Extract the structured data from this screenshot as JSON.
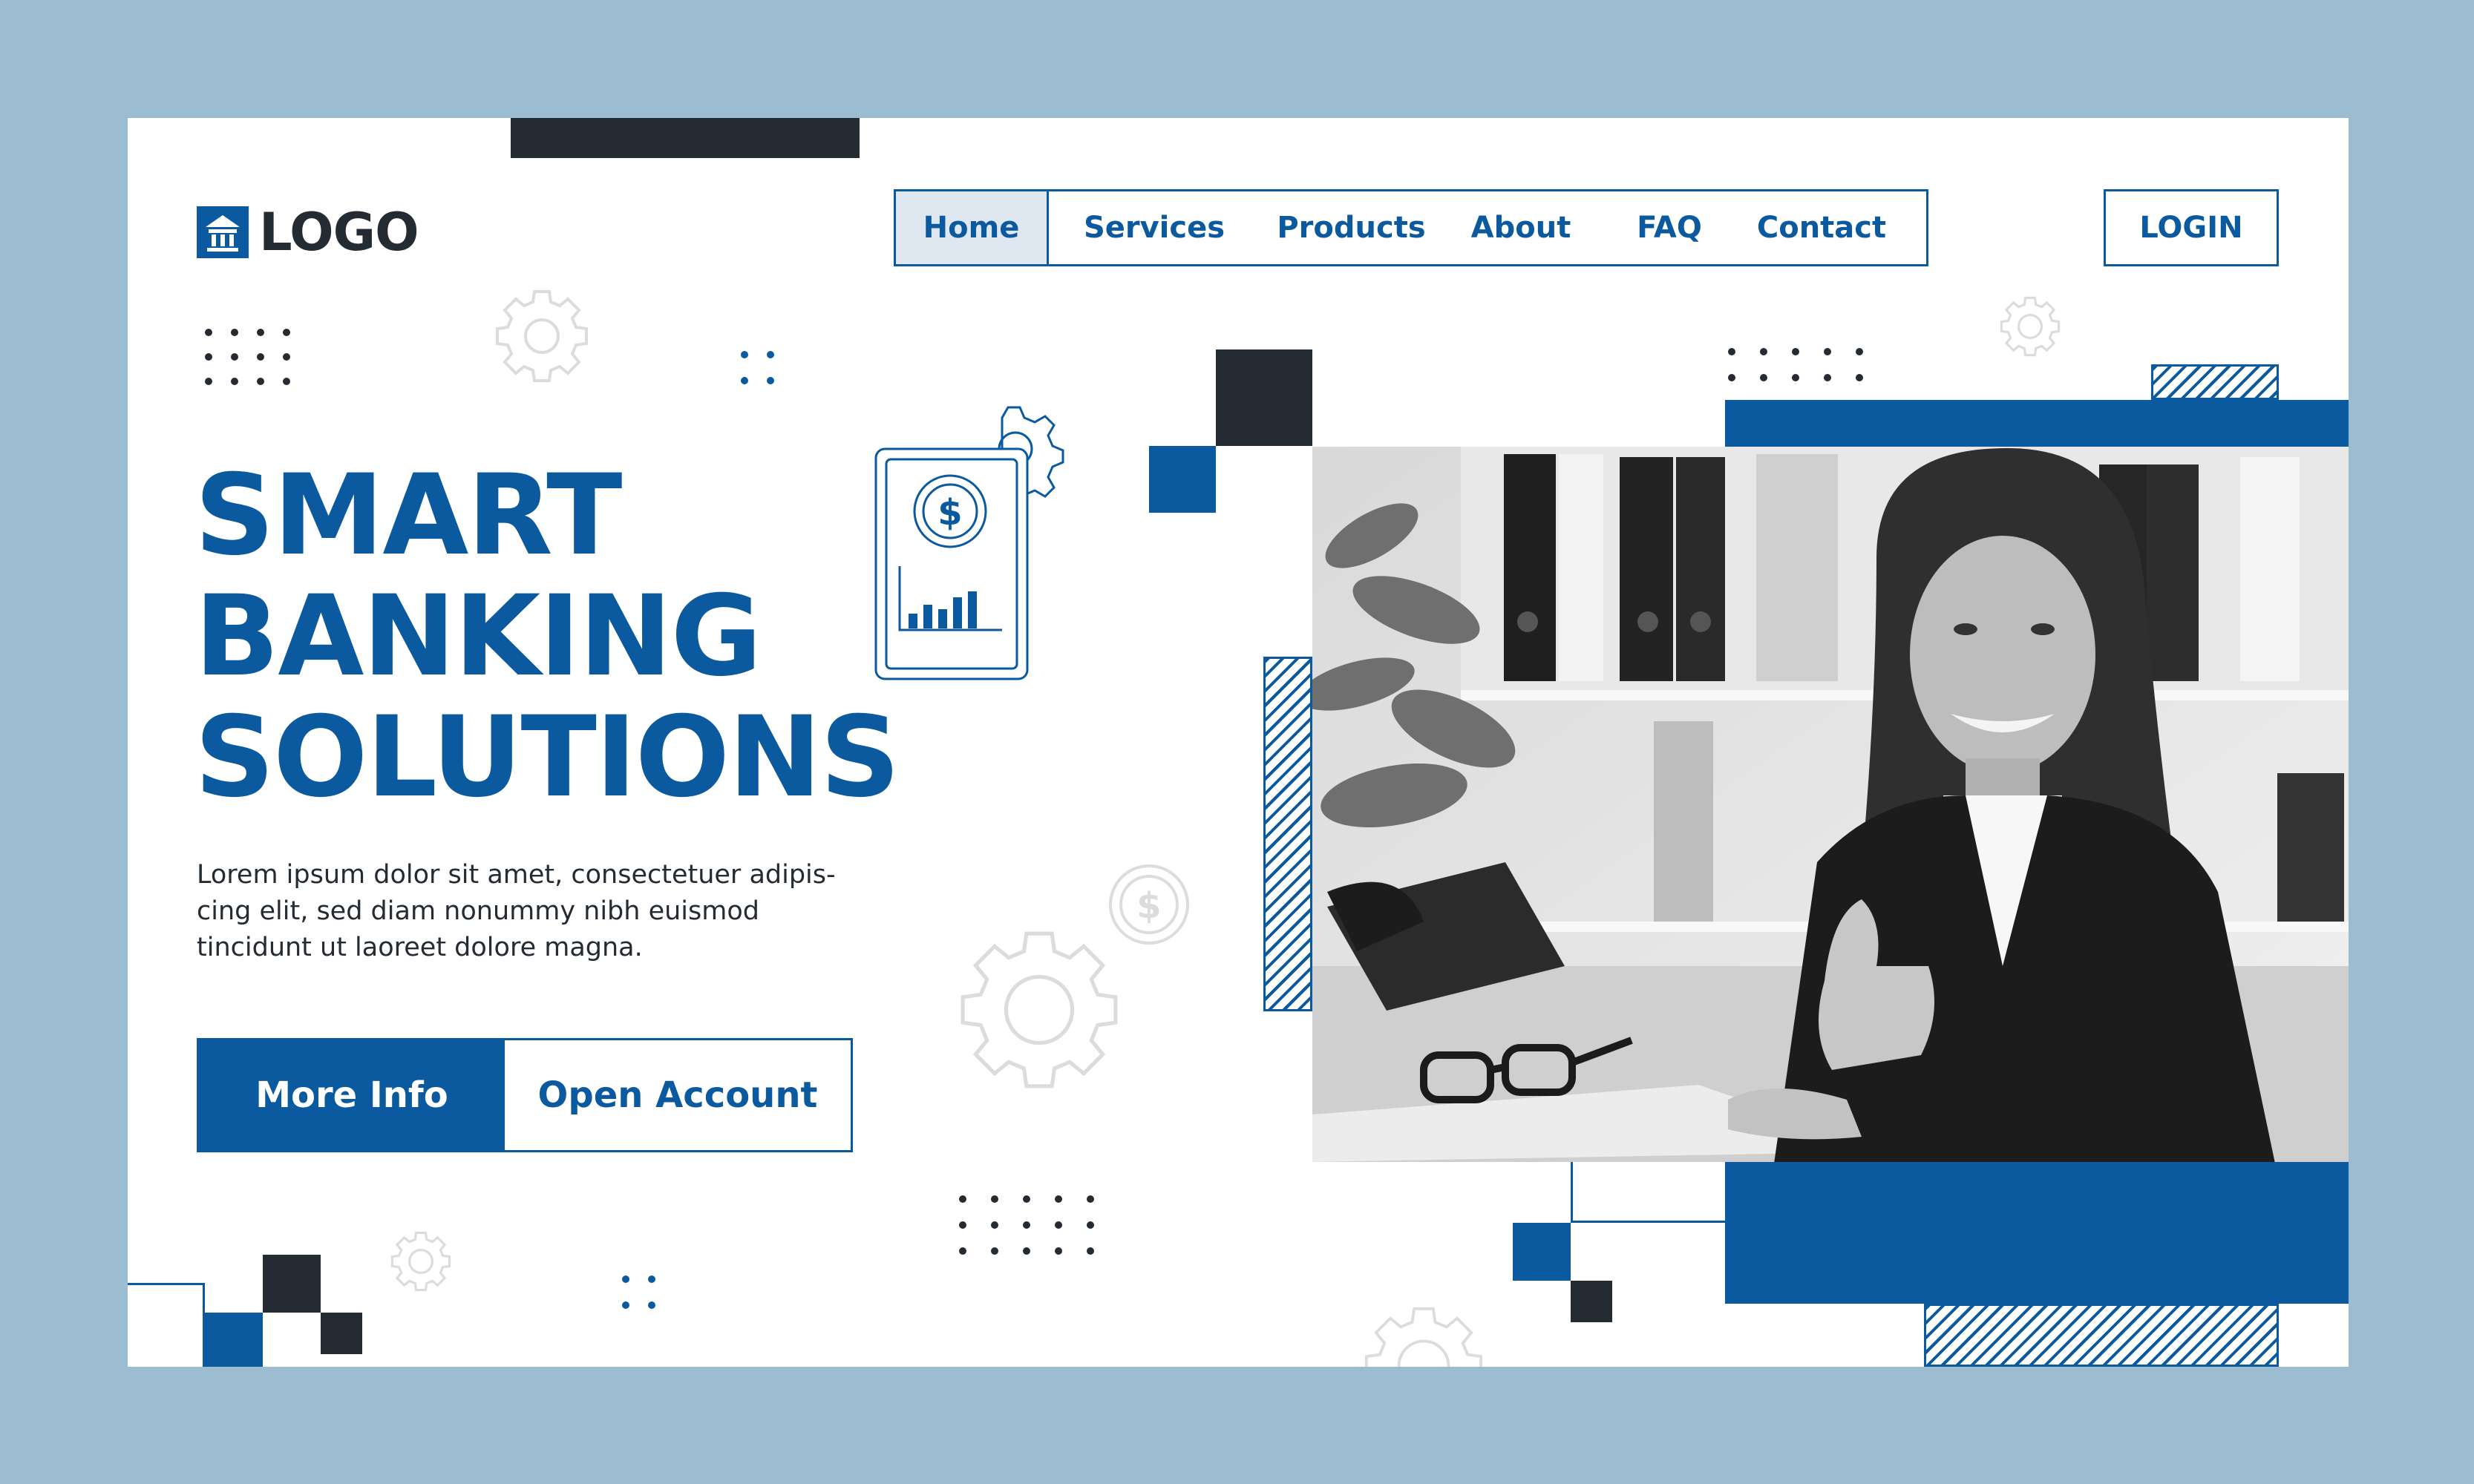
{
  "brand": {
    "logo_text": "LOGO",
    "logo_icon": "bank-icon"
  },
  "nav": {
    "items": [
      {
        "label": "Home",
        "active": true
      },
      {
        "label": "Services",
        "active": false
      },
      {
        "label": "Products",
        "active": false
      },
      {
        "label": "About",
        "active": false
      },
      {
        "label": "FAQ",
        "active": false
      },
      {
        "label": "Contact",
        "active": false
      }
    ],
    "login_label": "LOGIN"
  },
  "hero": {
    "headline_line1": "SMART",
    "headline_line2": "BANKING",
    "headline_line3": "SOLUTIONS",
    "description": "Lorem ipsum dolor sit amet, consectetuer adipis-cing elit, sed diam nonummy nibh euismod tincidunt ut laoreet dolore magna.",
    "more_info_label": "More Info",
    "open_account_label": "Open Account",
    "phone_screen_symbol": "$",
    "coin_symbol": "$"
  },
  "colors": {
    "accent": "#0b5a9f",
    "dark": "#252b33",
    "background": "#9bbcd1",
    "card": "#ffffff",
    "nav_active": "#dfe7f0"
  },
  "icons": [
    "bank-icon",
    "gear-icon",
    "dollar-coin-icon",
    "phone-finance-icon",
    "bar-chart-icon"
  ],
  "image": {
    "subject": "smiling businesswoman giving thumbs up at office desk"
  }
}
